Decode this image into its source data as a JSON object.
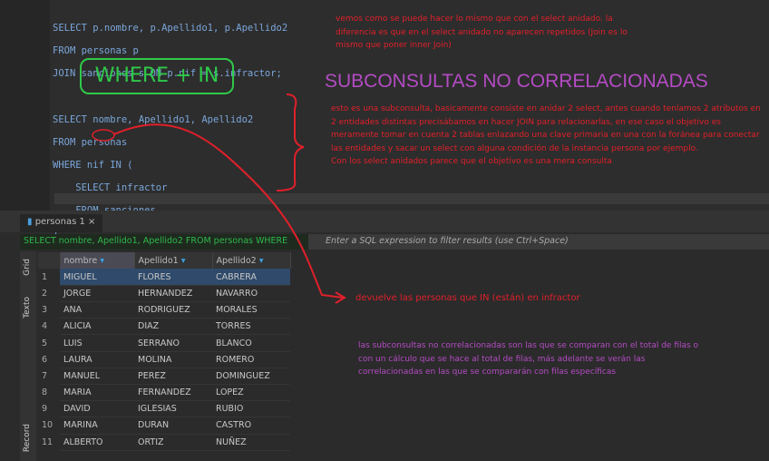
{
  "editor": {
    "query1": [
      "SELECT p.nombre, p.Apellido1, p.Apellido2",
      "FROM personas p",
      "JOIN sanciones s ON p.nif = s.infractor;"
    ],
    "heading_where_in": "WHERE + IN",
    "heading_sub": "SUBCONSULTAS NO CORRELACIONADAS",
    "note1": "vemos como se puede hacer lo mismo que con el select anidado. la diferencia es que en el select anidado no aparecen repetidos (Join es lo mismo que poner inner Join)",
    "query2": [
      "SELECT nombre, Apellido1, Apellido2",
      "FROM personas",
      "WHERE nif IN (",
      "    SELECT infractor",
      "    FROM sanciones",
      ");"
    ],
    "note2": "esto es una subconsulta, basicamente consiste en anidar 2 select, antes cuando teníamos 2 atributos en 2 entidades distintas precisábamos en hacer JOIN para relacionarlas, en ese caso el objetivo es meramente tomar en cuenta 2 tablas enlazando una clave primaria en una con la foránea para conectar las entidades y sacar un select con alguna condición de la instancia persona por ejemplo.",
    "note3": "Con los select anidados parece que el objetivo es una mera consulta"
  },
  "results": {
    "tab_label": "personas 1",
    "filter_sql": "SELECT nombre, Apellido1, Apellido2 FROM personas WHERE",
    "filter_placeholder": "Enter a SQL expression to filter results (use Ctrl+Space)",
    "side_tabs": [
      "Grid",
      "Texto",
      "Record"
    ],
    "columns": [
      "nombre",
      "Apellido1",
      "Apellido2"
    ],
    "rows": [
      [
        "MIGUEL",
        "FLORES",
        "CABRERA"
      ],
      [
        "JORGE",
        "HERNANDEZ",
        "NAVARRO"
      ],
      [
        "ANA",
        "RODRIGUEZ",
        "MORALES"
      ],
      [
        "ALICIA",
        "DIAZ",
        "TORRES"
      ],
      [
        "LUIS",
        "SERRANO",
        "BLANCO"
      ],
      [
        "LAURA",
        "MOLINA",
        "ROMERO"
      ],
      [
        "MANUEL",
        "PEREZ",
        "DOMINGUEZ"
      ],
      [
        "MARIA",
        "FERNANDEZ",
        "LOPEZ"
      ],
      [
        "DAVID",
        "IGLESIAS",
        "RUBIO"
      ],
      [
        "MARINA",
        "DURAN",
        "CASTRO"
      ],
      [
        "ALBERTO",
        "ORTIZ",
        "NUÑEZ"
      ]
    ],
    "note_in": "devuelve las personas que IN (están) en infractor",
    "note_sub": "las subconsultas no correlacionadas son las que se comparan con el total de filas o con un cálculo que se hace al total de filas, más adelante se verán las correlacionadas en las que se compararán con filas específicas"
  }
}
